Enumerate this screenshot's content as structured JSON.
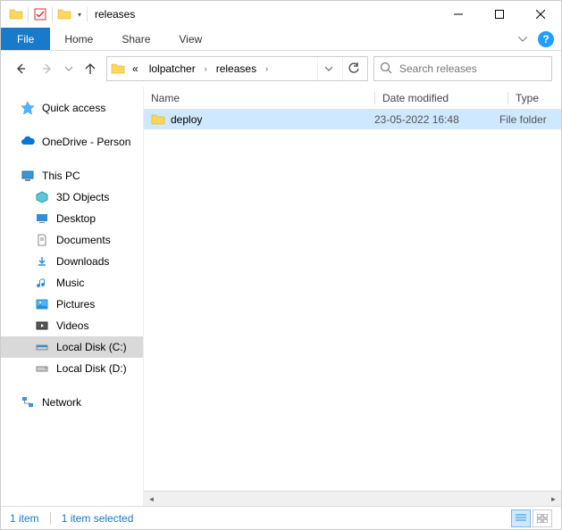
{
  "title": "releases",
  "qat_dropdown": "▾",
  "menu": {
    "file": "File",
    "home": "Home",
    "share": "Share",
    "view": "View"
  },
  "address": {
    "chevrons": "«",
    "crumbs": [
      "lolpatcher",
      "releases"
    ]
  },
  "search": {
    "placeholder": "Search releases"
  },
  "sidebar": {
    "quick_access": "Quick access",
    "onedrive": "OneDrive - Person",
    "this_pc": "This PC",
    "children": [
      {
        "label": "3D Objects"
      },
      {
        "label": "Desktop"
      },
      {
        "label": "Documents"
      },
      {
        "label": "Downloads"
      },
      {
        "label": "Music"
      },
      {
        "label": "Pictures"
      },
      {
        "label": "Videos"
      },
      {
        "label": "Local Disk (C:)"
      },
      {
        "label": "Local Disk (D:)"
      }
    ],
    "network": "Network"
  },
  "columns": {
    "name": "Name",
    "date": "Date modified",
    "type": "Type"
  },
  "files": [
    {
      "name": "deploy",
      "date": "23-05-2022 16:48",
      "type": "File folder"
    }
  ],
  "status": {
    "count": "1 item",
    "selected": "1 item selected"
  }
}
